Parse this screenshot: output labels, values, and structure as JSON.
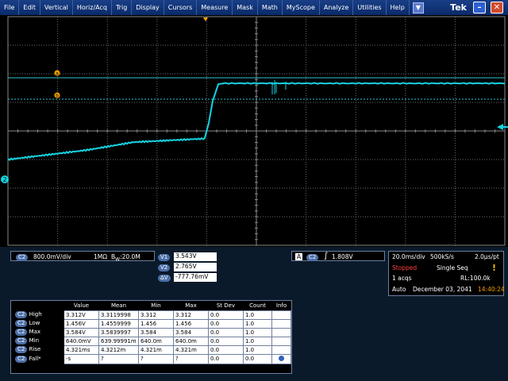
{
  "menu": {
    "items": [
      "File",
      "Edit",
      "Vertical",
      "Horiz/Acq",
      "Trig",
      "Display",
      "Cursors",
      "Measure",
      "Mask",
      "Math",
      "MyScope",
      "Analyze",
      "Utilities",
      "Help"
    ],
    "dropdown_icon": "triangle-down-icon",
    "brand": "Tek",
    "minimize_icon": "minimize-icon",
    "close_icon": "close-icon"
  },
  "graticule": {
    "markers": {
      "a": "a",
      "b": "b",
      "channel": "2"
    }
  },
  "colors": {
    "trace": "#15d3e0",
    "menubar": "#0f3478",
    "badge": "#4c6fa7"
  },
  "channel_panel": {
    "badge": "C2",
    "scale": "800.0mV/div",
    "coupling": "1MΩ",
    "bandwidth_prefix": "B",
    "bandwidth_sub": "W",
    "bandwidth": ":20.0M"
  },
  "cursor_panel": {
    "v1_label": "V1",
    "v1_value": "3.543V",
    "v2_label": "V2",
    "v2_value": "2.765V",
    "dv_label": "ΔV",
    "dv_value": "-777.76mV"
  },
  "trigger_panel": {
    "type_badge": "A",
    "channel_badge": "C2",
    "slope_icon": "rising-edge-icon",
    "level": "1.808V"
  },
  "acq_panel": {
    "timebase": "20.0ms/div",
    "sample_rate": "500kS/s",
    "resolution": "2.0μs/pt",
    "state": "Stopped",
    "mode": "Single Seq",
    "acqs": "1 acqs",
    "record_length": "RL:100.0k",
    "trigger_mode": "Auto",
    "date": "December 03, 2041",
    "time": "14:40:24",
    "state_color": "#ff4040",
    "time_color": "#f0a000"
  },
  "measurements": {
    "headers": [
      "Value",
      "Mean",
      "Min",
      "Max",
      "St Dev",
      "Count",
      "Info"
    ],
    "rows": [
      {
        "badge": "C2",
        "name": "High",
        "value": "3.312V",
        "mean": "3.3119998",
        "min": "3.312",
        "max": "3.312",
        "stdev": "0.0",
        "count": "1.0"
      },
      {
        "badge": "C2",
        "name": "Low",
        "value": "1.456V",
        "mean": "1.4559999",
        "min": "1.456",
        "max": "1.456",
        "stdev": "0.0",
        "count": "1.0"
      },
      {
        "badge": "C2",
        "name": "Max",
        "value": "3.584V",
        "mean": "3.5839997",
        "min": "3.584",
        "max": "3.584",
        "stdev": "0.0",
        "count": "1.0"
      },
      {
        "badge": "C2",
        "name": "Min",
        "value": "640.0mV",
        "mean": "639.99991m",
        "min": "640.0m",
        "max": "640.0m",
        "stdev": "0.0",
        "count": "1.0"
      },
      {
        "badge": "C2",
        "name": "Rise",
        "value": "4.321ms",
        "mean": "4.3212m",
        "min": "4.321m",
        "max": "4.321m",
        "stdev": "0.0",
        "count": "1.0"
      },
      {
        "badge": "C2",
        "name": "Fall*",
        "value": "-s",
        "mean": "?",
        "min": "?",
        "max": "?",
        "stdev": "0.0",
        "count": "0.0"
      }
    ],
    "info_icon": "info-button-icon"
  }
}
